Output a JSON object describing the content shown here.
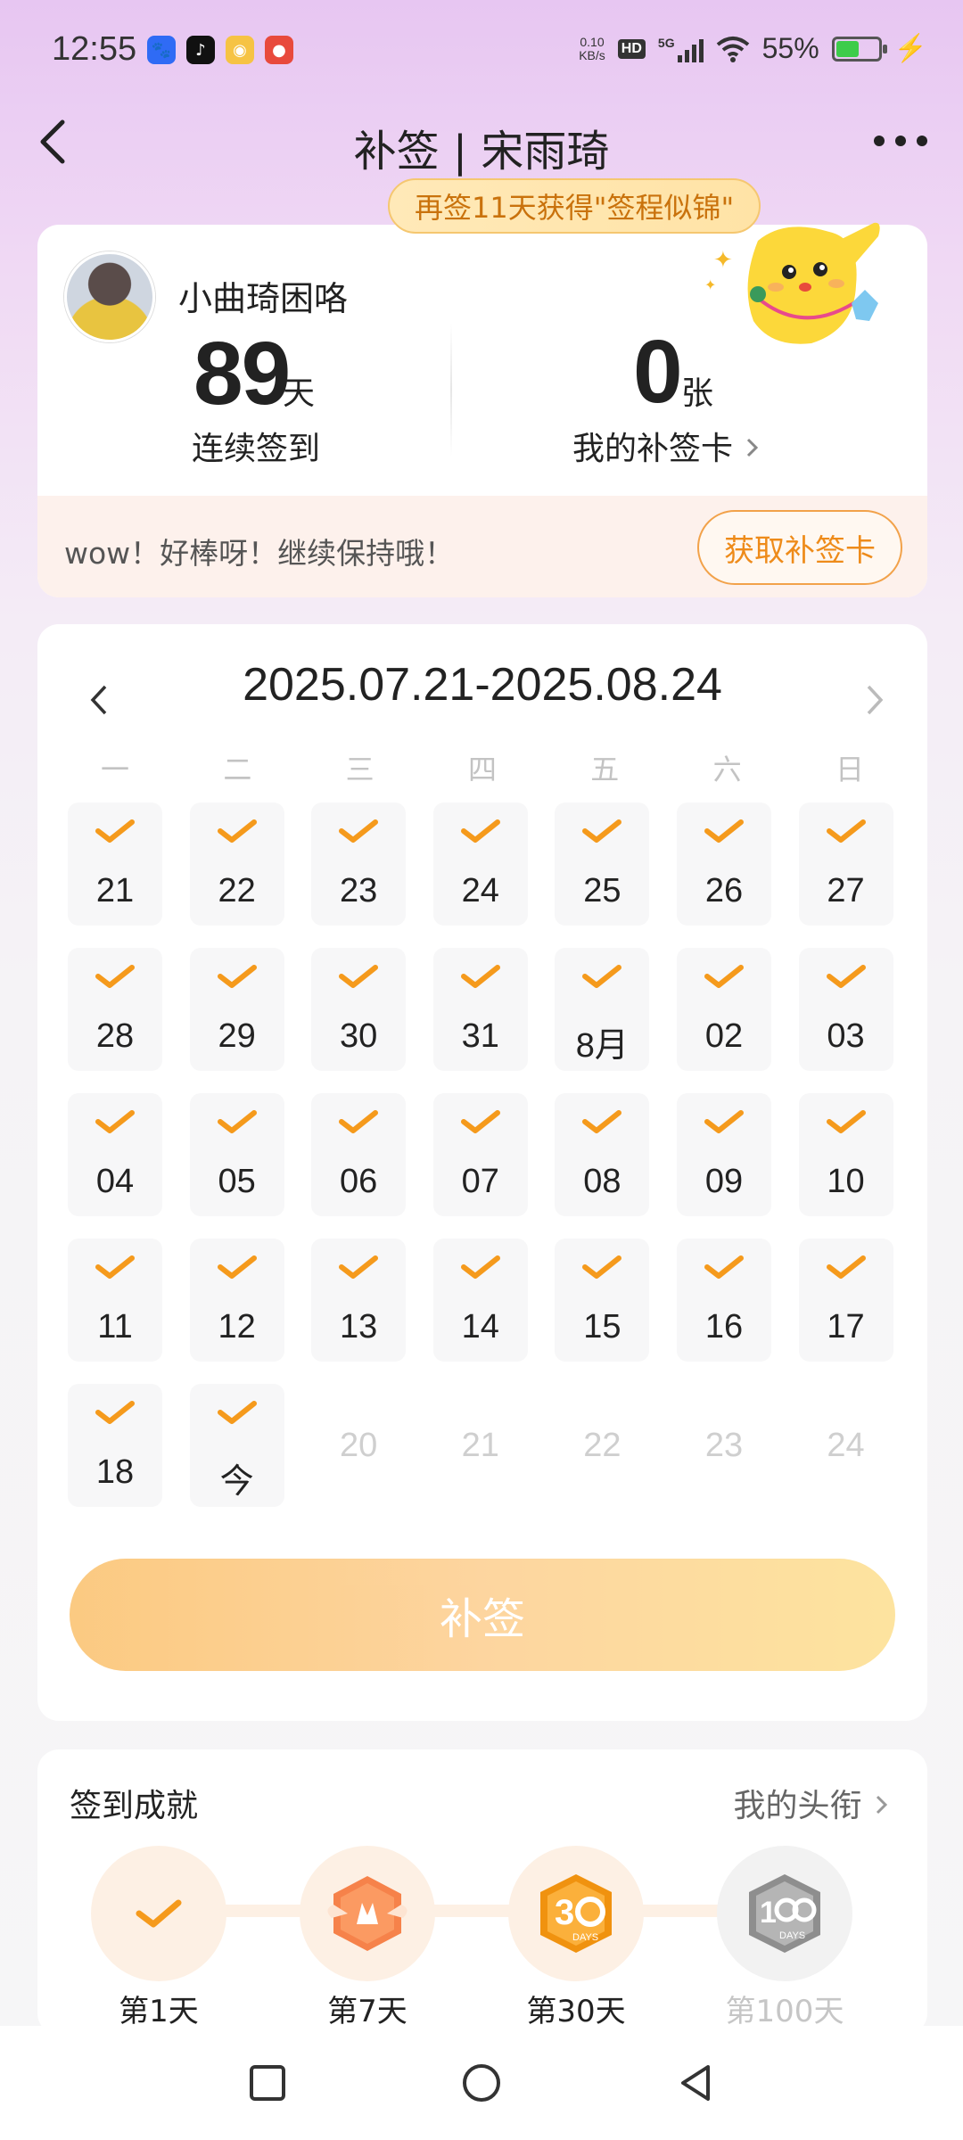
{
  "status_bar": {
    "time": "12:55",
    "net_speed": "0.10\nKB/s",
    "hd": "HD",
    "signal": "5G",
    "battery": "55%",
    "battery_level": 0.55,
    "apps": [
      "baidu-icon",
      "douyin-icon",
      "weibo-icon",
      "app-icon"
    ]
  },
  "header": {
    "title": "补签 | 宋雨琦"
  },
  "promo": "再签11天获得\"签程似锦\"",
  "profile": {
    "nickname": "小曲琦困咯",
    "streak_num": "89",
    "streak_unit": "天",
    "streak_label": "连续签到",
    "card_num": "0",
    "card_unit": "张",
    "card_label": "我的补签卡",
    "encourage": "wow！好棒呀！继续保持哦！",
    "get_card_btn": "获取补签卡"
  },
  "calendar": {
    "range": "2025.07.21-2025.08.24",
    "weekdays": [
      "一",
      "二",
      "三",
      "四",
      "五",
      "六",
      "日"
    ],
    "days": [
      {
        "label": "21",
        "checked": true
      },
      {
        "label": "22",
        "checked": true
      },
      {
        "label": "23",
        "checked": true
      },
      {
        "label": "24",
        "checked": true
      },
      {
        "label": "25",
        "checked": true
      },
      {
        "label": "26",
        "checked": true
      },
      {
        "label": "27",
        "checked": true
      },
      {
        "label": "28",
        "checked": true
      },
      {
        "label": "29",
        "checked": true
      },
      {
        "label": "30",
        "checked": true
      },
      {
        "label": "31",
        "checked": true
      },
      {
        "label": "8月",
        "checked": true
      },
      {
        "label": "02",
        "checked": true
      },
      {
        "label": "03",
        "checked": true
      },
      {
        "label": "04",
        "checked": true
      },
      {
        "label": "05",
        "checked": true
      },
      {
        "label": "06",
        "checked": true
      },
      {
        "label": "07",
        "checked": true
      },
      {
        "label": "08",
        "checked": true
      },
      {
        "label": "09",
        "checked": true
      },
      {
        "label": "10",
        "checked": true
      },
      {
        "label": "11",
        "checked": true
      },
      {
        "label": "12",
        "checked": true
      },
      {
        "label": "13",
        "checked": true
      },
      {
        "label": "14",
        "checked": true
      },
      {
        "label": "15",
        "checked": true
      },
      {
        "label": "16",
        "checked": true
      },
      {
        "label": "17",
        "checked": true
      },
      {
        "label": "18",
        "checked": true
      },
      {
        "label": "今",
        "checked": true
      },
      {
        "label": "20",
        "checked": false
      },
      {
        "label": "21",
        "checked": false
      },
      {
        "label": "22",
        "checked": false
      },
      {
        "label": "23",
        "checked": false
      },
      {
        "label": "24",
        "checked": false
      }
    ],
    "resign_btn": "补签"
  },
  "achievements": {
    "title": "签到成就",
    "link": "我的头衔",
    "items": [
      {
        "label": "第1天",
        "icon": "check-icon",
        "locked": false
      },
      {
        "label": "第7天",
        "icon": "badge-7-icon",
        "locked": false
      },
      {
        "label": "第30天",
        "icon": "badge-30-days-icon",
        "locked": false
      },
      {
        "label": "第100天",
        "icon": "badge-100-days-icon",
        "locked": true
      }
    ]
  },
  "colors": {
    "accent": "#f0921c",
    "check": "#f59a1c",
    "button_gradient_start": "#fbc77b",
    "button_gradient_end": "#fde29a",
    "future_day": "#cfcfcf"
  }
}
